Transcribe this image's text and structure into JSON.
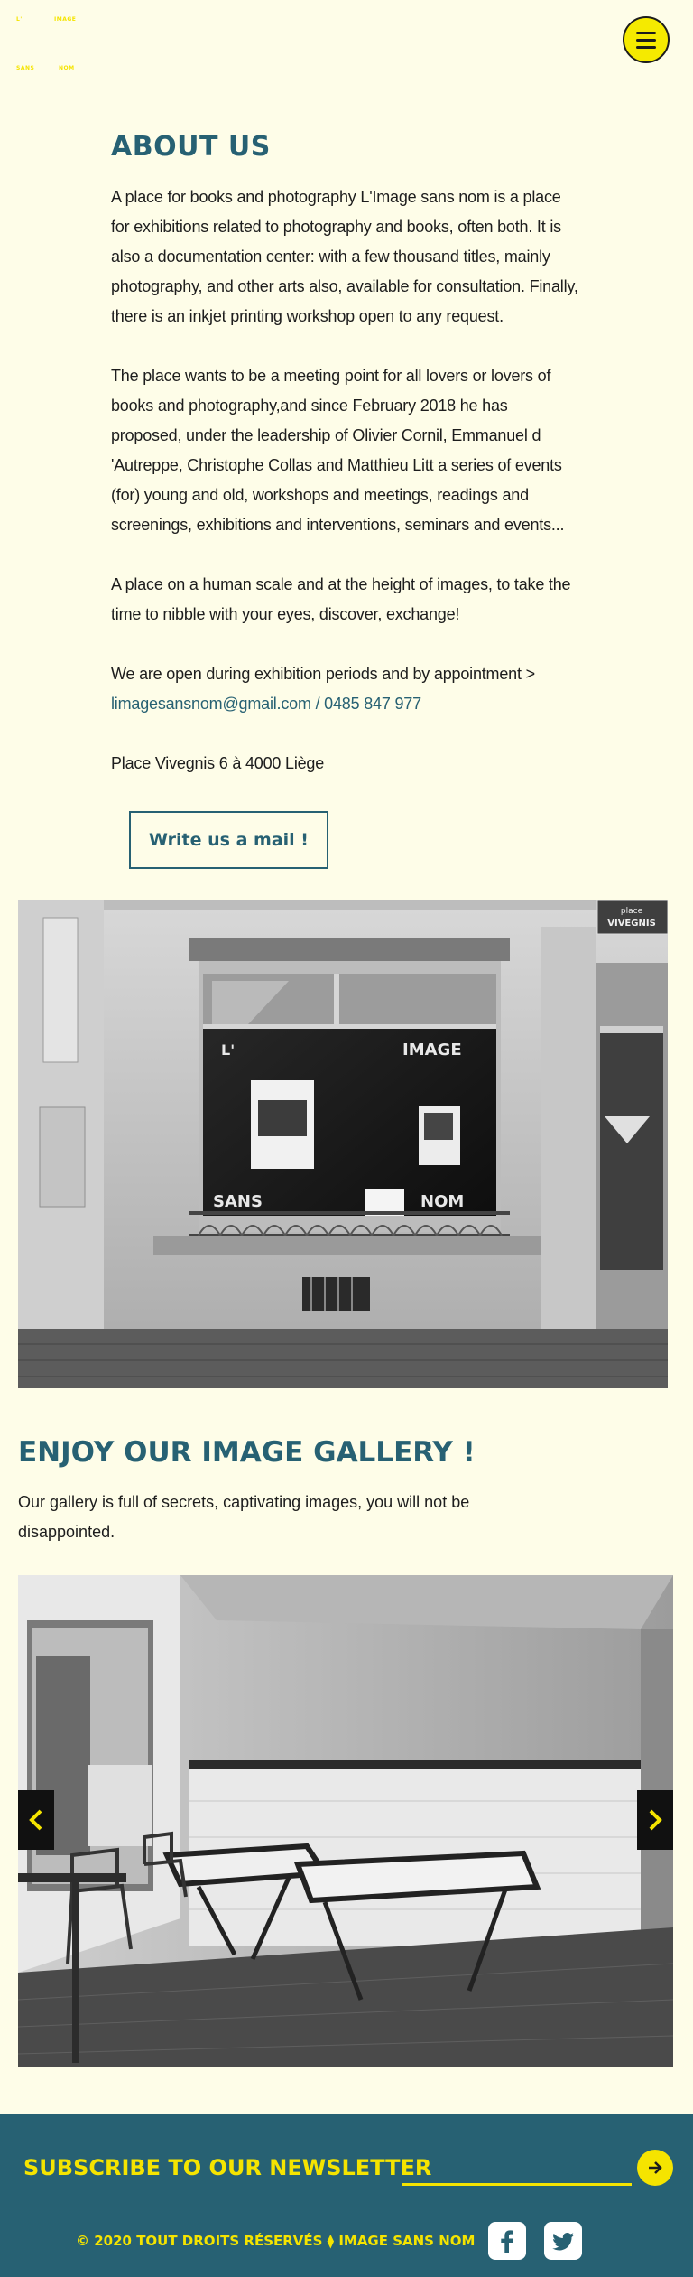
{
  "header": {
    "logo_words": [
      "L'",
      "IMAGE",
      "SANS",
      "NOM"
    ],
    "menu_icon": "hamburger-icon"
  },
  "about": {
    "title": "ABOUT US",
    "paragraphs": [
      " A place for books and photography L'Image sans nom is a place for exhibitions related to photography and books, often both. It is also a documentation center: with a few thousand titles, mainly photography, and other arts also, available for consultation. Finally, there is an inkjet printing workshop open to any request.",
      "The place wants to be a meeting point for all lovers or lovers of books and photography,and since February 2018 he has proposed, under the leadership of Olivier Cornil, Emmanuel d 'Autreppe, Christophe Collas and Matthieu Litt a series of events (for) young and old, workshops and meetings, readings and screenings, exhibitions and interventions, seminars and events...",
      "A place on a human scale and at the height of images, to take the time to nibble with your eyes, discover, exchange!"
    ],
    "open_text": "We are open during exhibition periods and by appointment > ",
    "email": "limagesansnom@gmail.com",
    "separator": " / ",
    "phone": "0485 847 977",
    "address": "Place Vivegnis 6 à 4000 Liège",
    "mail_button": "Write us a mail !"
  },
  "storefront": {
    "sign_street": "place",
    "sign_name": "VIVEGNIS",
    "window_words": [
      "L'",
      "IMAGE",
      "SANS",
      "NOM"
    ]
  },
  "gallery": {
    "title": "ENJOY OUR IMAGE GALLERY !",
    "description": "Our gallery is full of secrets, captivating images, you will not be disappointed.",
    "prev_icon": "chevron-left-icon",
    "next_icon": "chevron-right-icon"
  },
  "footer": {
    "newsletter_label": "SUBSCRIBE TO OUR NEWSLETTER",
    "newsletter_placeholder": "",
    "submit_icon": "arrow-right-icon",
    "copyright": "© 2020 TOUT DROITS RÉSERVÉS ⧫ IMAGE SANS NOM",
    "social": [
      "facebook-icon",
      "twitter-icon"
    ]
  },
  "colors": {
    "background": "#fefde8",
    "accent": "#276173",
    "yellow": "#f5e400"
  }
}
